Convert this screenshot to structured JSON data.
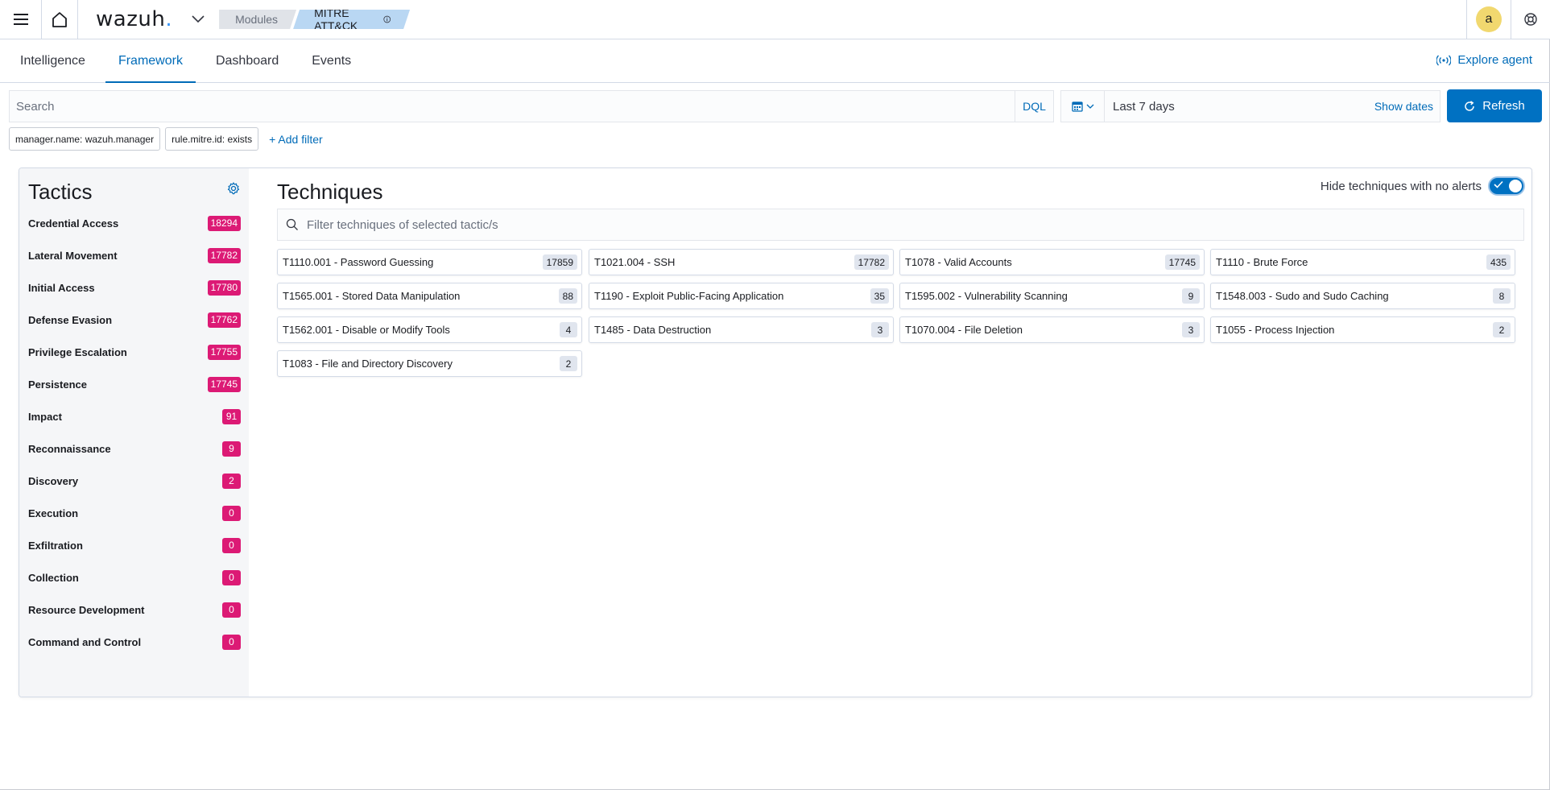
{
  "header": {
    "logo_text": "wazuh",
    "logo_dot": ".",
    "breadcrumbs": [
      "Modules",
      "MITRE ATT&CK"
    ],
    "avatar_initial": "a"
  },
  "tabs": [
    {
      "label": "Intelligence",
      "active": false
    },
    {
      "label": "Framework",
      "active": true
    },
    {
      "label": "Dashboard",
      "active": false
    },
    {
      "label": "Events",
      "active": false
    }
  ],
  "explore_agent_label": "Explore agent",
  "search": {
    "placeholder": "Search",
    "language": "DQL"
  },
  "datepicker": {
    "range": "Last 7 days",
    "show_dates_label": "Show dates"
  },
  "refresh_label": "Refresh",
  "filters": [
    "manager.name: wazuh.manager",
    "rule.mitre.id: exists"
  ],
  "add_filter_label": "+ Add filter",
  "tactics_title": "Tactics",
  "tactics": [
    {
      "name": "Credential Access",
      "count": "18294"
    },
    {
      "name": "Lateral Movement",
      "count": "17782"
    },
    {
      "name": "Initial Access",
      "count": "17780"
    },
    {
      "name": "Defense Evasion",
      "count": "17762"
    },
    {
      "name": "Privilege Escalation",
      "count": "17755"
    },
    {
      "name": "Persistence",
      "count": "17745"
    },
    {
      "name": "Impact",
      "count": "91"
    },
    {
      "name": "Reconnaissance",
      "count": "9"
    },
    {
      "name": "Discovery",
      "count": "2"
    },
    {
      "name": "Execution",
      "count": "0"
    },
    {
      "name": "Exfiltration",
      "count": "0"
    },
    {
      "name": "Collection",
      "count": "0"
    },
    {
      "name": "Resource Development",
      "count": "0"
    },
    {
      "name": "Command and Control",
      "count": "0"
    }
  ],
  "techniques_title": "Techniques",
  "hide_toggle_label": "Hide techniques with no alerts",
  "hide_toggle_on": true,
  "technique_filter_placeholder": "Filter techniques of selected tactic/s",
  "techniques": [
    {
      "name": "T1110.001 - Password Guessing",
      "count": "17859"
    },
    {
      "name": "T1021.004 - SSH",
      "count": "17782"
    },
    {
      "name": "T1078 - Valid Accounts",
      "count": "17745"
    },
    {
      "name": "T1110 - Brute Force",
      "count": "435"
    },
    {
      "name": "T1565.001 - Stored Data Manipulation",
      "count": "88"
    },
    {
      "name": "T1190 - Exploit Public-Facing Application",
      "count": "35"
    },
    {
      "name": "T1595.002 - Vulnerability Scanning",
      "count": "9"
    },
    {
      "name": "T1548.003 - Sudo and Sudo Caching",
      "count": "8"
    },
    {
      "name": "T1562.001 - Disable or Modify Tools",
      "count": "4"
    },
    {
      "name": "T1485 - Data Destruction",
      "count": "3"
    },
    {
      "name": "T1070.004 - File Deletion",
      "count": "3"
    },
    {
      "name": "T1055 - Process Injection",
      "count": "2"
    },
    {
      "name": "T1083 - File and Directory Discovery",
      "count": "2"
    }
  ],
  "colors": {
    "accent": "#006bb8",
    "badge": "#dc1a75",
    "primary_button": "#0071c2"
  }
}
